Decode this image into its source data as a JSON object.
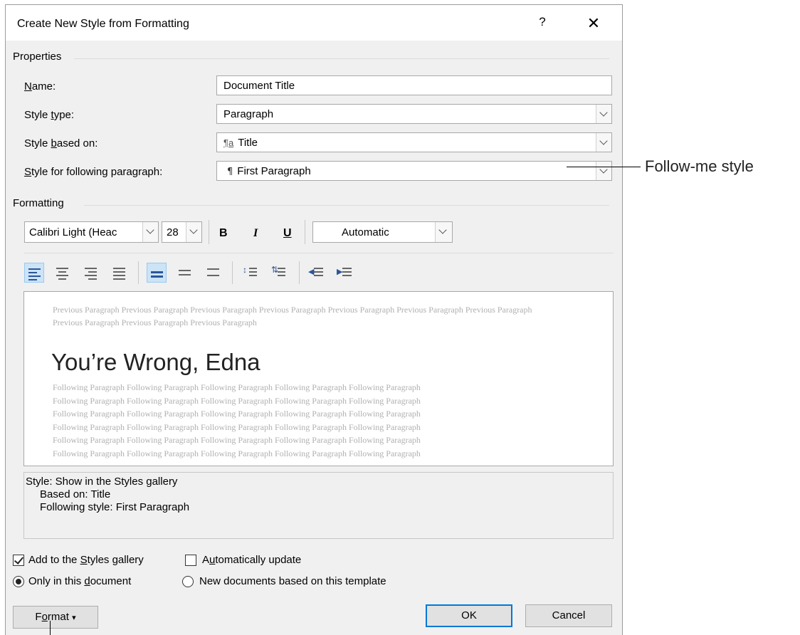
{
  "dialog": {
    "title": "Create New Style from Formatting",
    "help_label": "?",
    "close_label": "✕"
  },
  "properties": {
    "section_label": "Properties",
    "name": {
      "label_u": "N",
      "label_rest": "ame:",
      "value": "Document Title"
    },
    "style_type": {
      "label_pre": "Style ",
      "label_u": "t",
      "label_rest": "ype:",
      "value": "Paragraph"
    },
    "style_based_on": {
      "label_pre": "Style ",
      "label_u": "b",
      "label_rest": "ased on:",
      "glyph": "¶a",
      "value": "Title"
    },
    "style_following": {
      "label_u": "S",
      "label_rest": "tyle for following paragraph:",
      "glyph": "¶",
      "value": "First Paragraph"
    }
  },
  "formatting": {
    "section_label": "Formatting",
    "font": "Calibri Light (Heac",
    "size": "28",
    "bold": "B",
    "italic": "I",
    "underline": "U",
    "color": "Automatic"
  },
  "preview": {
    "previous_paragraph": "Previous Paragraph Previous Paragraph Previous Paragraph Previous Paragraph Previous Paragraph Previous Paragraph Previous Paragraph Previous Paragraph Previous Paragraph Previous Paragraph",
    "sample_text": "You’re Wrong, Edna",
    "following_lines": [
      "Following Paragraph Following Paragraph Following Paragraph Following Paragraph Following Paragraph",
      "Following Paragraph Following Paragraph Following Paragraph Following Paragraph Following Paragraph",
      "Following Paragraph Following Paragraph Following Paragraph Following Paragraph Following Paragraph",
      "Following Paragraph Following Paragraph Following Paragraph Following Paragraph Following Paragraph",
      "Following Paragraph Following Paragraph Following Paragraph Following Paragraph Following Paragraph",
      "Following Paragraph Following Paragraph Following Paragraph Following Paragraph Following Paragraph"
    ]
  },
  "description": {
    "line1": "Style: Show in the Styles gallery",
    "line2": "Based on: Title",
    "line3": "Following style: First Paragraph"
  },
  "options": {
    "add_to_gallery": {
      "pre": "Add to the ",
      "u": "S",
      "rest": "tyles gallery",
      "checked": true
    },
    "auto_update": {
      "pre": "A",
      "u": "u",
      "rest": "tomatically update",
      "checked": false
    },
    "only_this_doc": {
      "pre": "Only in this ",
      "u": "d",
      "rest": "ocument",
      "checked": true
    },
    "new_docs": {
      "label": "New documents based on this template",
      "checked": false
    }
  },
  "buttons": {
    "format_pre": "F",
    "format_u": "o",
    "format_rest": "rmat",
    "format_arrow": "▾",
    "ok": "OK",
    "cancel": "Cancel"
  },
  "callout": {
    "text": "Follow-me style"
  }
}
